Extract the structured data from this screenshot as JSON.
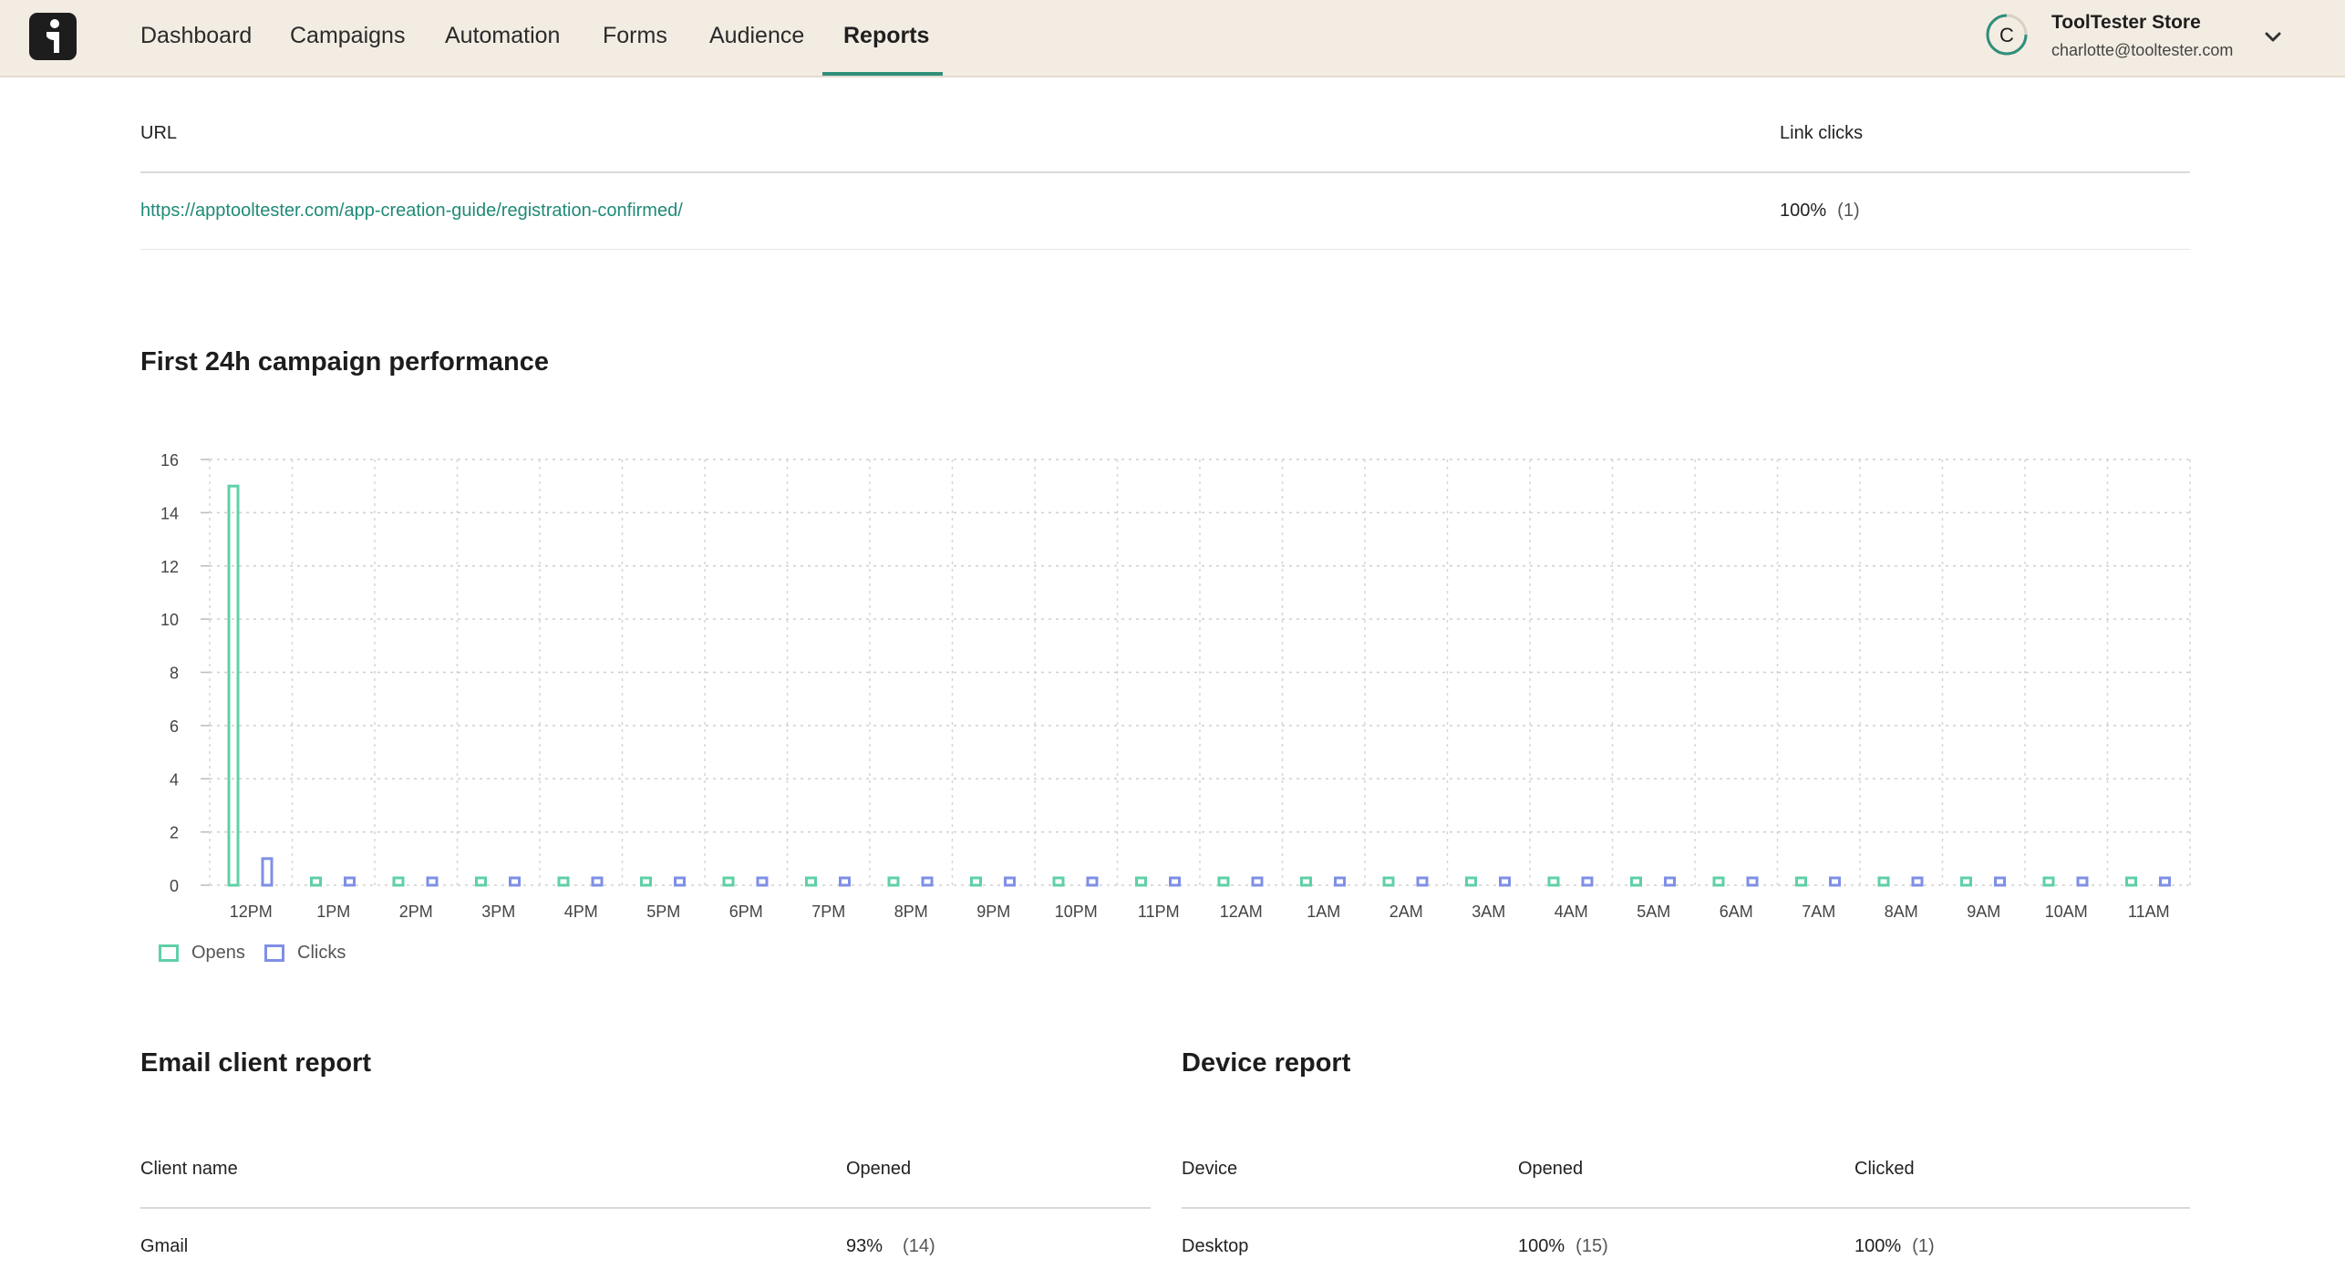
{
  "nav": {
    "items": [
      {
        "label": "Dashboard",
        "active": false
      },
      {
        "label": "Campaigns",
        "active": false
      },
      {
        "label": "Automation",
        "active": false
      },
      {
        "label": "Forms",
        "active": false
      },
      {
        "label": "Audience",
        "active": false
      },
      {
        "label": "Reports",
        "active": true
      }
    ]
  },
  "account": {
    "initial": "C",
    "name": "ToolTester Store",
    "email": "charlotte@tooltester.com"
  },
  "links_table": {
    "headers": {
      "url": "URL",
      "clicks": "Link clicks"
    },
    "rows": [
      {
        "url": "https://apptooltester.com/app-creation-guide/registration-confirmed/",
        "percent": "100%",
        "count": "(1)"
      }
    ]
  },
  "performance": {
    "title": "First 24h campaign performance"
  },
  "chart_data": {
    "type": "bar",
    "categories": [
      "12PM",
      "1PM",
      "2PM",
      "3PM",
      "4PM",
      "5PM",
      "6PM",
      "7PM",
      "8PM",
      "9PM",
      "10PM",
      "11PM",
      "12AM",
      "1AM",
      "2AM",
      "3AM",
      "4AM",
      "5AM",
      "6AM",
      "7AM",
      "8AM",
      "9AM",
      "10AM",
      "11AM"
    ],
    "series": [
      {
        "name": "Opens",
        "color": "#5fd0a6",
        "values": [
          15,
          0,
          0,
          0,
          0,
          0,
          0,
          0,
          0,
          0,
          0,
          0,
          0,
          0,
          0,
          0,
          0,
          0,
          0,
          0,
          0,
          0,
          0,
          0
        ]
      },
      {
        "name": "Clicks",
        "color": "#7f8fe6",
        "values": [
          1,
          0,
          0,
          0,
          0,
          0,
          0,
          0,
          0,
          0,
          0,
          0,
          0,
          0,
          0,
          0,
          0,
          0,
          0,
          0,
          0,
          0,
          0,
          0
        ]
      }
    ],
    "yticks": [
      0,
      2,
      4,
      6,
      8,
      10,
      12,
      14,
      16
    ],
    "ylim": [
      0,
      16
    ],
    "grid": true,
    "legend": "bottom-left"
  },
  "email_client_report": {
    "title": "Email client report",
    "headers": {
      "name": "Client name",
      "opened": "Opened"
    },
    "rows": [
      {
        "name": "Gmail",
        "percent": "93%",
        "count": "(14)"
      }
    ]
  },
  "device_report": {
    "title": "Device report",
    "headers": {
      "device": "Device",
      "opened": "Opened",
      "clicked": "Clicked"
    },
    "rows": [
      {
        "device": "Desktop",
        "opened_percent": "100%",
        "opened_count": "(15)",
        "clicked_percent": "100%",
        "clicked_count": "(1)"
      }
    ]
  }
}
